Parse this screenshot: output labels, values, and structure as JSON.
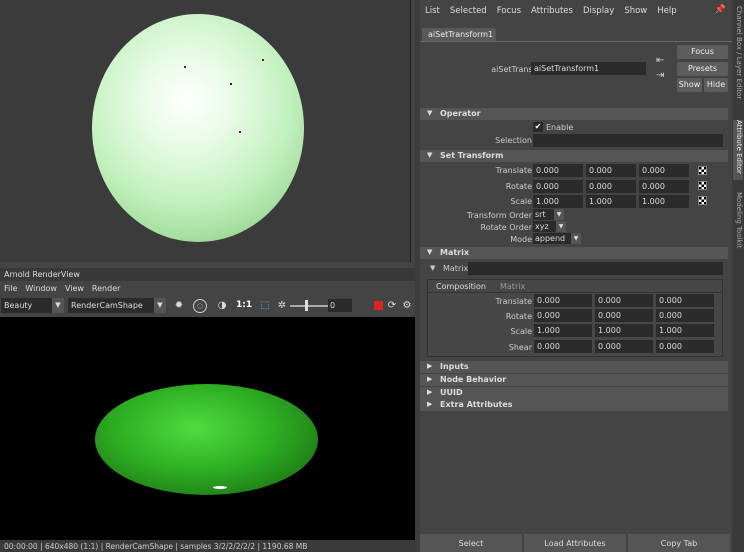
{
  "render_view": {
    "title": "Arnold RenderView",
    "menu": [
      "File",
      "Window",
      "View",
      "Render"
    ],
    "aov": "Beauty",
    "camera": "RenderCamShape",
    "zoom": "1:1",
    "exposure_value": "0",
    "status": "00:00:00 | 640x480 (1:1) | RenderCamShape | samples 3/2/2/2/2/2 | 1190.68 MB"
  },
  "attribute_editor": {
    "menu": [
      "List",
      "Selected",
      "Focus",
      "Attributes",
      "Display",
      "Show",
      "Help"
    ],
    "tab": "aiSetTransform1",
    "node_label": "aiSetTransform:",
    "node_value": "aiSetTransform1",
    "buttons": {
      "focus": "Focus",
      "presets": "Presets",
      "show": "Show",
      "hide": "Hide"
    },
    "operator": {
      "title": "Operator",
      "enable_label": "Enable",
      "selection_label": "Selection",
      "selection_value": ""
    },
    "set_transform": {
      "title": "Set Transform",
      "translate_label": "Translate",
      "translate": [
        "0.000",
        "0.000",
        "0.000"
      ],
      "rotate_label": "Rotate",
      "rotate": [
        "0.000",
        "0.000",
        "0.000"
      ],
      "scale_label": "Scale",
      "scale": [
        "1.000",
        "1.000",
        "1.000"
      ],
      "transform_order_label": "Transform Order",
      "transform_order": "srt",
      "rotate_order_label": "Rotate Order",
      "rotate_order": "xyz",
      "mode_label": "Mode",
      "mode": "append"
    },
    "matrix": {
      "title": "Matrix",
      "field_label": "Matrix",
      "tabs": [
        "Composition",
        "Matrix"
      ],
      "translate_label": "Translate",
      "translate": [
        "0.000",
        "0.000",
        "0.000"
      ],
      "rotate_label": "Rotate",
      "rotate": [
        "0.000",
        "0.000",
        "0.000"
      ],
      "scale_label": "Scale",
      "scale": [
        "1.000",
        "1.000",
        "1.000"
      ],
      "shear_label": "Shear",
      "shear": [
        "0.000",
        "0.000",
        "0.000"
      ]
    },
    "collapsed_sections": [
      "Inputs",
      "Node Behavior",
      "UUID",
      "Extra Attributes"
    ],
    "bottom_buttons": [
      "Select",
      "Load Attributes",
      "Copy Tab"
    ]
  },
  "side_tabs": [
    "Channel Box / Layer Editor",
    "Attribute Editor",
    "Modeling Toolkit"
  ],
  "colors": {
    "stop_button": "#dd2222",
    "render_object": "#2eaf23",
    "viewport_sphere": "#c4f1c0"
  }
}
